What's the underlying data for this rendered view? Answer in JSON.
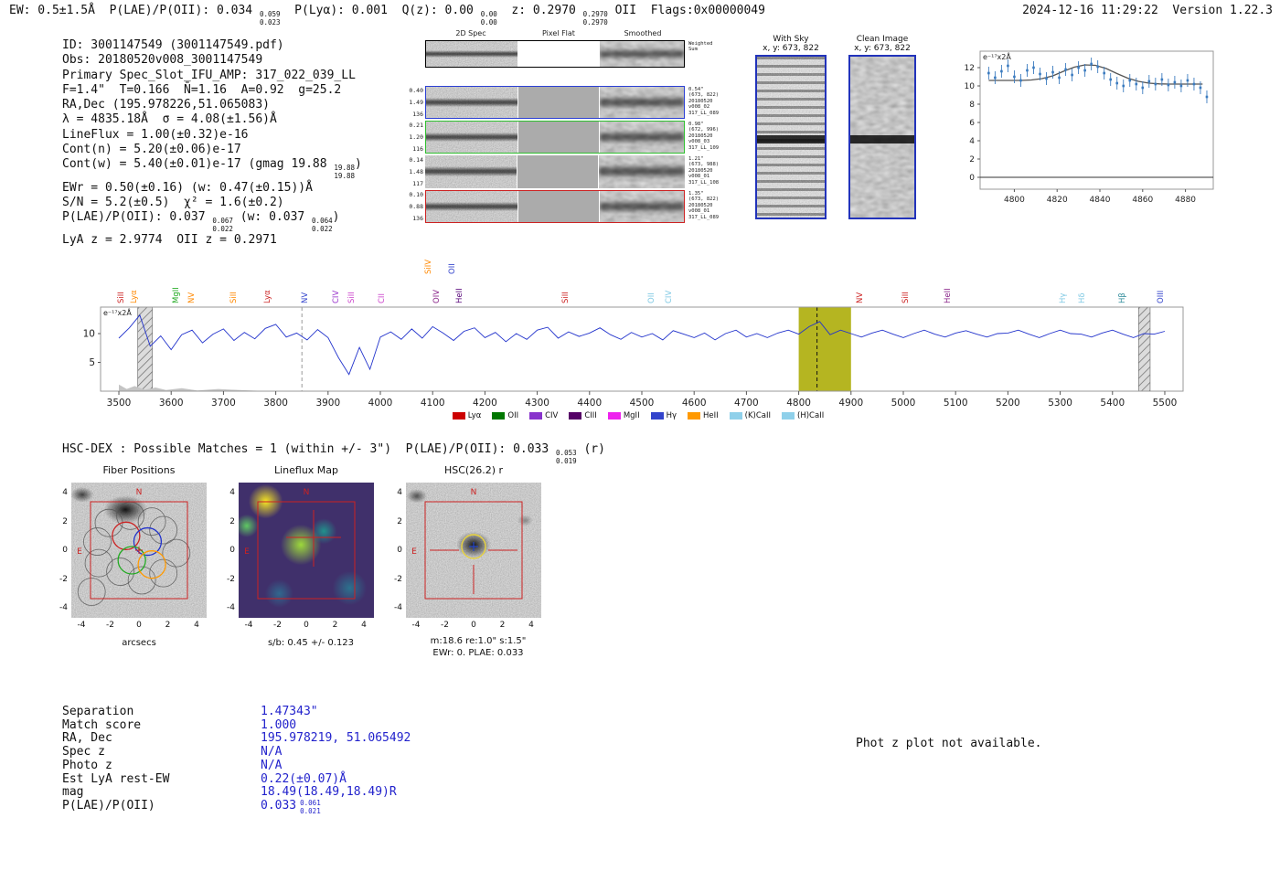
{
  "header": {
    "parts": [
      {
        "t": "EW: 0.5±1.5Å  "
      },
      {
        "t": "P(LAE)/P(OII): 0.034 ",
        "sup": "0.059",
        "sub": "0.023"
      },
      {
        "t": "  P(Lyα): 0.001  "
      },
      {
        "t": "Q(z): 0.00 ",
        "sup": "0.00",
        "sub": "0.00"
      },
      {
        "t": "  z: 0.2970 ",
        "sup": "0.2970",
        "sub": "0.2970"
      },
      {
        "t": " OII  "
      },
      {
        "t": "Flags:0x00000049"
      }
    ],
    "right": "2024-12-16 11:29:22  Version 1.22.3"
  },
  "info": {
    "lines": [
      [
        {
          "t": "ID: 3001147549 (3001147549.pdf)"
        }
      ],
      [
        {
          "t": "Obs: 20180520v008_3001147549"
        }
      ],
      [
        {
          "t": "Primary Spec_Slot_IFU_AMP: 317_022_039_LL"
        }
      ],
      [
        {
          "t": "F=1.4\"  T=0.166  N̄=1.16  A=0.92  g=25.2"
        }
      ],
      [
        {
          "t": "RA,Dec (195.978226,51.065083)"
        }
      ],
      [
        {
          "t": "λ = 4835.18Å  σ = 4.08(±1.56)Å"
        }
      ],
      [
        {
          "t": "LineFlux = 1.00(±0.32)e-16"
        }
      ],
      [
        {
          "t": "Cont(n) = 5.20(±0.06)e-17"
        }
      ],
      [
        {
          "t": "Cont(w) = 5.40(±0.01)e-17 (gmag 19.88 "
        },
        {
          "sup": "19.88",
          "sub": "19.88"
        },
        {
          "t": ")"
        }
      ],
      [
        {
          "t": "EWr = 0.50(±0.16) (w: 0.47(±0.15))Å"
        }
      ],
      [
        {
          "t": "S/N = 5.2(±0.5)  χ² = 1.6(±0.2)"
        }
      ],
      [
        {
          "t": "P(LAE)/P(OII): 0.037 "
        },
        {
          "sup": "0.067",
          "sub": "0.022"
        },
        {
          "t": " (w: 0.037 "
        },
        {
          "sup": "0.064",
          "sub": "0.022"
        },
        {
          "t": ")"
        }
      ],
      [
        {
          "t": "LyA z = 2.9774  OII z = 0.2971"
        }
      ]
    ]
  },
  "cutouts2d": {
    "col_headers": [
      "2D Spec",
      "Pixel Flat",
      "Smoothed"
    ],
    "rows": [
      {
        "nums": [],
        "note": "Weighted\nSum",
        "frame": "#000000"
      },
      {
        "nums": [
          "0.40",
          "1.49",
          "136"
        ],
        "note": "0.54\"\n(673, 822)\n20180520\nv008_02\n317_LL_089",
        "frame": "#2b3fd4"
      },
      {
        "nums": [
          "0.21",
          "1.20",
          "116"
        ],
        "note": "0.98\"\n(672, 996)\n20180520\nv008_03\n317_LL_109",
        "frame": "#2fbf2f"
      },
      {
        "nums": [
          "0.14",
          "1.48",
          "117"
        ],
        "note": "1.21\"\n(673, 988)\n20180520\nv008_01\n317_LL_108",
        "frame": "none"
      },
      {
        "nums": [
          "0.10",
          "0.88",
          "136"
        ],
        "note": "1.35\"\n(673, 822)\n20180520\nv008_01\n317_LL_089",
        "frame": "#cc2222"
      }
    ]
  },
  "sky_panels": {
    "with_sky": {
      "title": "With Sky",
      "subtitle": "x, y: 673, 822"
    },
    "clean": {
      "title": "Clean Image",
      "subtitle": "x, y: 673, 822"
    }
  },
  "chart_data": [
    {
      "type": "scatter",
      "label": "e⁻¹⁷x2Å",
      "x": [
        4788,
        4791,
        4794,
        4797,
        4800,
        4803,
        4806,
        4809,
        4812,
        4815,
        4818,
        4821,
        4824,
        4827,
        4830,
        4833,
        4836,
        4839,
        4842,
        4845,
        4848,
        4851,
        4854,
        4857,
        4860,
        4863,
        4866,
        4869,
        4872,
        4875,
        4878,
        4881,
        4884,
        4887,
        4890
      ],
      "y": [
        11.4,
        10.9,
        11.6,
        12.2,
        11.0,
        10.6,
        11.7,
        12.0,
        11.3,
        10.8,
        11.5,
        10.9,
        11.8,
        11.2,
        12.0,
        11.7,
        12.4,
        12.1,
        11.4,
        10.7,
        10.3,
        10.0,
        10.6,
        10.2,
        9.8,
        10.5,
        10.2,
        10.7,
        10.1,
        10.4,
        10.0,
        10.6,
        10.2,
        9.8,
        8.8
      ],
      "yerr": 0.7,
      "fit_x": [
        4788,
        4793,
        4798,
        4803,
        4808,
        4813,
        4818,
        4823,
        4828,
        4833,
        4838,
        4843,
        4848,
        4853,
        4858,
        4863,
        4868,
        4873,
        4878,
        4883,
        4888
      ],
      "fit_y": [
        10.6,
        10.6,
        10.6,
        10.6,
        10.65,
        10.8,
        11.1,
        11.6,
        12.05,
        12.3,
        12.25,
        11.9,
        11.35,
        10.85,
        10.5,
        10.3,
        10.22,
        10.2,
        10.2,
        10.2,
        10.2
      ],
      "xticks": [
        4800,
        4820,
        4840,
        4860,
        4880
      ],
      "yticks": [
        0,
        2,
        4,
        6,
        8,
        10,
        12
      ],
      "xlim": [
        4784,
        4893
      ],
      "ylim": [
        -1.3,
        13.8
      ],
      "marker_color": "#3b7bbf",
      "fit_color": "#555555"
    },
    {
      "type": "line",
      "label": "e⁻¹⁷x2Å",
      "x_start": 3500,
      "x_step": 20,
      "values": [
        9.2,
        11.0,
        13.2,
        7.8,
        9.6,
        7.2,
        9.8,
        10.6,
        8.4,
        9.9,
        10.8,
        8.8,
        10.2,
        9.1,
        10.9,
        11.6,
        9.4,
        10.1,
        8.9,
        10.7,
        9.3,
        5.8,
        2.9,
        7.6,
        3.8,
        9.4,
        10.3,
        9.0,
        10.8,
        9.2,
        11.2,
        10.1,
        8.8,
        10.4,
        11.0,
        9.3,
        10.2,
        8.6,
        10.0,
        9.0,
        10.6,
        11.1,
        9.2,
        10.3,
        9.5,
        10.1,
        11.0,
        9.8,
        9.0,
        10.2,
        9.4,
        10.0,
        8.9,
        10.5,
        9.9,
        9.3,
        10.1,
        8.9,
        10.0,
        10.6,
        9.4,
        10.0,
        9.3,
        10.1,
        10.6,
        9.9,
        11.2,
        12.1,
        9.8,
        10.6,
        10.0,
        9.4,
        10.1,
        10.6,
        9.9,
        9.3,
        10.0,
        10.6,
        9.9,
        9.4,
        10.1,
        10.5,
        9.9,
        9.4,
        10.0,
        10.1,
        10.6,
        9.9,
        9.3,
        10.0,
        10.6,
        10.0,
        9.9,
        9.4,
        10.1,
        10.6,
        9.9,
        9.3,
        10.0,
        9.9,
        10.4
      ],
      "color": "#2233cc",
      "xticks": [
        3500,
        3600,
        3700,
        3800,
        3900,
        4000,
        4100,
        4200,
        4300,
        4400,
        4500,
        4600,
        4700,
        4800,
        4900,
        5000,
        5100,
        5200,
        5300,
        5400,
        5500
      ],
      "yticks": [
        5,
        10
      ],
      "xlim": [
        3465,
        5535
      ],
      "ylim": [
        0,
        14.6
      ],
      "highlight_band": {
        "x0": 4800,
        "x1": 4900,
        "color": "#b5b521"
      },
      "dashed_lines": [
        {
          "x": 3850,
          "color": "#999999"
        },
        {
          "x": 4835,
          "color": "#111111"
        }
      ],
      "hatch_bands": [
        {
          "x0": 3536,
          "x1": 3564
        },
        {
          "x0": 5450,
          "x1": 5472
        }
      ]
    }
  ],
  "spec_lines": {
    "labels": [
      {
        "name": "SiII",
        "wave": 3518,
        "color": "#cc2222"
      },
      {
        "name": "Lyα",
        "wave": 3542,
        "color": "#ff8800"
      },
      {
        "name": "MgII",
        "wave": 3622,
        "color": "#22aa22"
      },
      {
        "name": "NV",
        "wave": 3652,
        "color": "#ff8800"
      },
      {
        "name": "SiII",
        "wave": 3732,
        "color": "#ff8800"
      },
      {
        "name": "Lyα",
        "wave": 3798,
        "color": "#cc2222"
      },
      {
        "name": "NV",
        "wave": 3868,
        "color": "#3344cc"
      },
      {
        "name": "CIV",
        "wave": 3928,
        "color": "#9933cc"
      },
      {
        "name": "SiII",
        "wave": 3958,
        "color": "#cc44cc"
      },
      {
        "name": "CII",
        "wave": 4015,
        "color": "#cc44cc"
      },
      {
        "name": "SiIV",
        "wave": 4105,
        "color": "#ff8800",
        "high": true
      },
      {
        "name": "OII",
        "wave": 4150,
        "color": "#3344cc",
        "high": true
      },
      {
        "name": "OIV",
        "wave": 4120,
        "color": "#882288"
      },
      {
        "name": "HeII",
        "wave": 4165,
        "color": "#550077"
      },
      {
        "name": "SiII",
        "wave": 4368,
        "color": "#cc2222"
      },
      {
        "name": "OII",
        "wave": 4532,
        "color": "#7ec8e3"
      },
      {
        "name": "CIV",
        "wave": 4565,
        "color": "#7ec8e3"
      },
      {
        "name": "NV",
        "wave": 4930,
        "color": "#cc2222"
      },
      {
        "name": "SiII",
        "wave": 5018,
        "color": "#cc2222"
      },
      {
        "name": "HeII",
        "wave": 5098,
        "color": "#882288"
      },
      {
        "name": "Hγ",
        "wave": 5318,
        "color": "#7ec8e3"
      },
      {
        "name": "Hδ",
        "wave": 5355,
        "color": "#7ec8e3"
      },
      {
        "name": "Hβ",
        "wave": 5432,
        "color": "#2e8b9a"
      },
      {
        "name": "OIII",
        "wave": 5505,
        "color": "#3344cc"
      }
    ],
    "legend": [
      {
        "name": "Lyα",
        "color": "#cc0000"
      },
      {
        "name": "OII",
        "color": "#007700"
      },
      {
        "name": "CIV",
        "color": "#8833cc"
      },
      {
        "name": "CIII",
        "color": "#550066"
      },
      {
        "name": "MgII",
        "color": "#ee22ee"
      },
      {
        "name": "Hγ",
        "color": "#3344cc"
      },
      {
        "name": "HeII",
        "color": "#ff9900"
      },
      {
        "name": "(K)CaII",
        "color": "#8fd0ea"
      },
      {
        "name": "(H)CaII",
        "color": "#8fd0ea"
      }
    ]
  },
  "hsc_header": {
    "segs": [
      {
        "t": "HSC-DEX : Possible Matches = 1 (within +/- 3\")  P(LAE)/P(OII): 0.033 "
      },
      {
        "sup": "0.053",
        "sub": "0.019"
      },
      {
        "t": " (r)"
      }
    ]
  },
  "panels": {
    "yticks": [
      "4",
      "2",
      "0",
      "-2",
      "-4"
    ],
    "xticks": [
      "-4",
      "-2",
      "0",
      "2",
      "4"
    ],
    "fiber": {
      "title": "Fiber Positions",
      "xlabel": "arcsecs",
      "compass": {
        "n": "N",
        "e": "E"
      },
      "gray_fibers": [
        [
          -2.1,
          1.9
        ],
        [
          -0.6,
          2.4
        ],
        [
          0.9,
          2.0
        ],
        [
          -2.9,
          0.6
        ],
        [
          1.7,
          1.4
        ],
        [
          -2.8,
          -0.9
        ],
        [
          -1.3,
          -1.5
        ],
        [
          0.2,
          -2.1
        ],
        [
          1.7,
          -1.6
        ],
        [
          -3.3,
          -2.9
        ],
        [
          2.6,
          -0.2
        ]
      ],
      "colored_fibers": [
        {
          "c": "#cc2222",
          "p": [
            -0.9,
            1.0
          ]
        },
        {
          "c": "#2233cc",
          "p": [
            0.6,
            0.6
          ]
        },
        {
          "c": "#22aa22",
          "p": [
            -0.5,
            -0.7
          ]
        },
        {
          "c": "#ff9900",
          "p": [
            0.9,
            -1.0
          ]
        }
      ]
    },
    "lineflux": {
      "title": "Lineflux Map",
      "caption": "s/b: 0.45 +/- 0.123",
      "compass": {
        "n": "N",
        "e": "E"
      }
    },
    "hscimg": {
      "title": "HSC(26.2) r",
      "caption1": "m:18.6 re:1.0\" s:1.5\"",
      "caption2": "EWr: 0. PLAE: 0.033",
      "compass": {
        "n": "N",
        "e": "E"
      }
    }
  },
  "match_table": {
    "rows": [
      {
        "label": "Separation",
        "value": "1.47343\""
      },
      {
        "label": "Match score",
        "value": "1.000"
      },
      {
        "label": "RA, Dec",
        "value": "195.978219, 51.065492"
      },
      {
        "label": "Spec z",
        "value": "N/A"
      },
      {
        "label": "Photo z",
        "value": "N/A"
      },
      {
        "label": "Est LyA rest-EW",
        "value": "0.22(±0.07)Å"
      },
      {
        "label": "mag",
        "value": "18.49(18.49,18.49)R"
      },
      {
        "label": "P(LAE)/P(OII)",
        "value": "0.033",
        "sup": "0.061",
        "sub": "0.021"
      }
    ]
  },
  "notes": {
    "photz": "Phot z plot not available."
  }
}
